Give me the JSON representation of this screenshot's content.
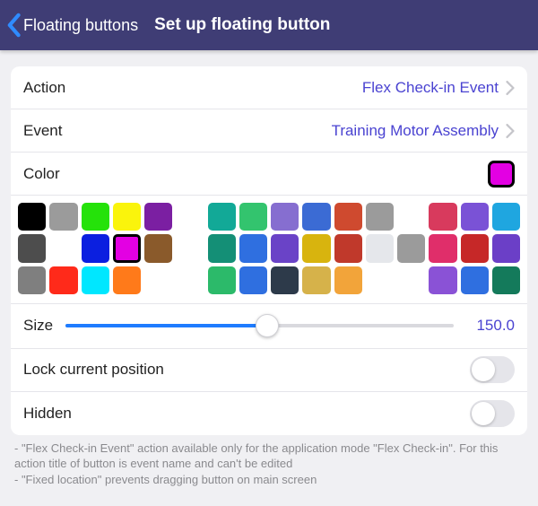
{
  "header": {
    "back_label": "Floating buttons",
    "title": "Set up floating button"
  },
  "rows": {
    "action": {
      "label": "Action",
      "value": "Flex Check-in Event"
    },
    "event": {
      "label": "Event",
      "value": "Training Motor Assembly"
    },
    "color": {
      "label": "Color",
      "selected_hex": "#e300e3"
    }
  },
  "palette": [
    [
      "#000000",
      "#9b9b9b",
      "#25e20a",
      "#faf40c",
      "#7b1fa2",
      null,
      "#12a997",
      "#33c46e",
      "#866ed0",
      "#3b6bd4",
      "#cf4a2f",
      "#9b9b9b",
      null,
      "#d83a5d",
      "#7a52d6",
      "#1fa6e0"
    ],
    [
      "#4d4d4d",
      "#ffffff",
      "#0b1fe0",
      "#e300e3",
      "#8a5a2b",
      null,
      "#148f76",
      "#2f6fe0",
      "#6a43c7",
      "#d8b40e",
      "#c0392b",
      "#e5e7eb",
      "#9b9b9b",
      "#e02e6a",
      "#c62828",
      "#6b3fc7"
    ],
    [
      "#7f7f7f",
      "#ff2a1a",
      "#00e7ff",
      "#ff7a1a",
      null,
      null,
      "#2cba6a",
      "#2f6fe0",
      "#2d3a4a",
      "#d6b24a",
      "#f2a43a",
      null,
      null,
      "#8a52d6",
      "#2f6fe0",
      "#147a5b"
    ]
  ],
  "palette_selected": [
    1,
    3
  ],
  "size": {
    "label": "Size",
    "value": "150.0",
    "percent": 52
  },
  "toggles": {
    "lock": {
      "label": "Lock current position",
      "on": false
    },
    "hidden": {
      "label": "Hidden",
      "on": false
    }
  },
  "footer": {
    "line1": "- \"Flex Check-in Event\" action available only for the application mode \"Flex Check-in\". For this action title of button is event name and can't be edited",
    "line2": "- \"Fixed location\" prevents dragging button on main screen"
  }
}
